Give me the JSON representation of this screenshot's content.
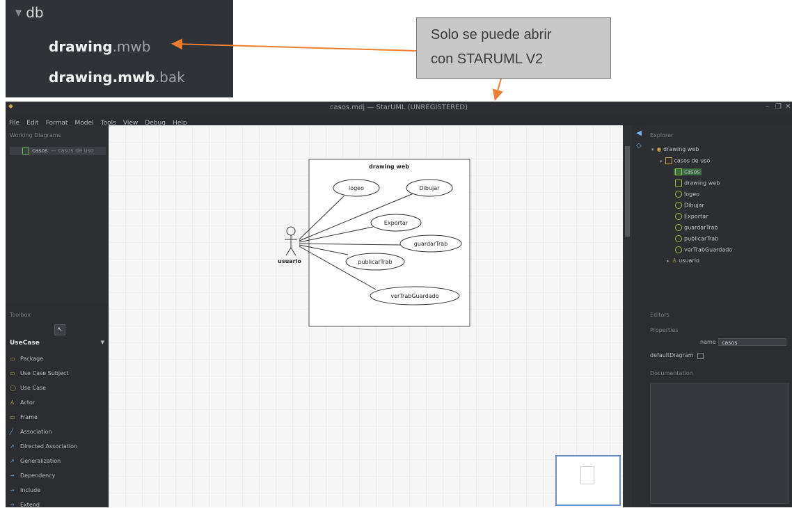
{
  "file_tree": {
    "folder_name": "db",
    "file1": {
      "base": "drawing",
      "ext": ".mwb"
    },
    "file2": {
      "base": "drawing.mwb",
      "ext": ".bak"
    }
  },
  "callout": {
    "line1": "Solo se puede abrir",
    "line2": "con STARUML V2"
  },
  "colors": {
    "arrow": "#ed7d31",
    "canvas": "#f6f6f6",
    "dark_panel": "#2b2d31",
    "selection": "#3e6b46"
  },
  "app": {
    "title": "casos.mdj — StarUML (UNREGISTERED)",
    "menu": [
      "File",
      "Edit",
      "Format",
      "Model",
      "Tools",
      "View",
      "Debug",
      "Help"
    ],
    "working_diagrams": {
      "header": "Working Diagrams",
      "item": "casos",
      "item_sub": "— casos de uso"
    },
    "toolbox": {
      "header": "Toolbox",
      "group": "UseCase",
      "tools": [
        "Package",
        "Use Case Subject",
        "Use Case",
        "Actor",
        "Frame",
        "Association",
        "Directed Association",
        "Generalization",
        "Dependency",
        "Include",
        "Extend"
      ]
    },
    "diagram": {
      "subject_title": "drawing web",
      "actor": "usuario",
      "use_cases": [
        "logeo",
        "Dibujar",
        "Exportar",
        "guardarTrab",
        "publicarTrab",
        "verTrabGuardado"
      ]
    },
    "explorer": {
      "header": "Explorer",
      "nodes": [
        "drawing web",
        "casos de uso",
        "casos",
        "drawing web",
        "logeo",
        "Dibujar",
        "Exportar",
        "guardarTrab",
        "publicarTrab",
        "verTrabGuardado",
        "usuario"
      ]
    },
    "editors": {
      "header": "Editors",
      "properties": "Properties",
      "name_label": "name",
      "name_value": "casos",
      "default_diagram_label": "defaultDiagram",
      "documentation": "Documentation"
    }
  }
}
